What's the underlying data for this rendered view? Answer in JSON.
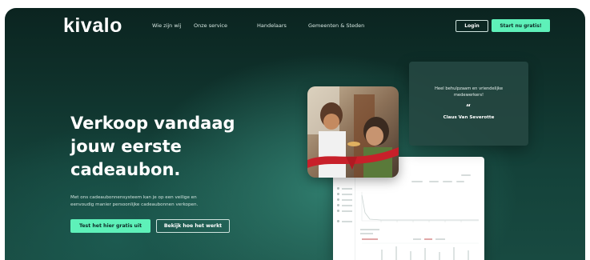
{
  "brand": {
    "logo": "kivalo"
  },
  "nav": {
    "links": [
      "Wie zijn wij",
      "Onze service",
      "Handelaars",
      "Gemeenten & Steden"
    ],
    "login": "Login",
    "cta": "Start nu gratis!"
  },
  "hero": {
    "title_line1": "Verkoop vandaag",
    "title_line2": "jouw eerste",
    "title_line3": "cadeaubon.",
    "subtitle_line1": "Met ons cadeaubonnensysteem kan je op een veilige en",
    "subtitle_line2": "eenvoudig manier persoonlijke cadeaubonnen verkopen.",
    "primary_button": "Test het hier gratis uit",
    "secondary_button": "Bekijk hoe het werkt"
  },
  "testimonial": {
    "quote_line1": "Heel behulpzaam en vriendelijke",
    "quote_line2": "medewerkers!",
    "author": "Claus Van Severotte"
  },
  "colors": {
    "accent": "#5ef1b9",
    "background_dark": "#0b2420",
    "background_teal": "#2f7b6c"
  }
}
